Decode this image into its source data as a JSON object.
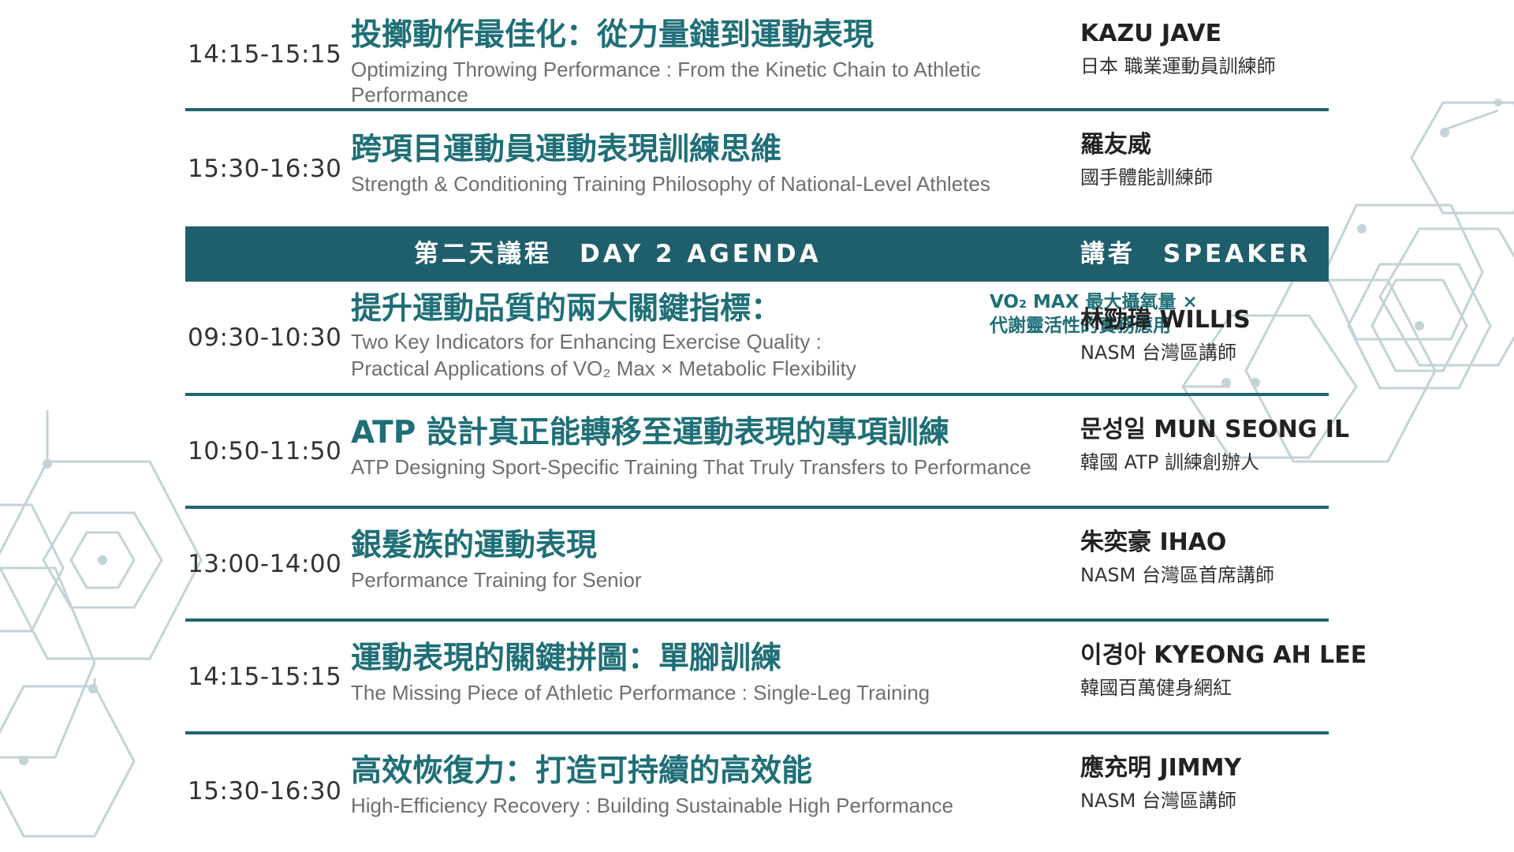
{
  "day1_sessions": [
    {
      "time": "14:15-15:15",
      "title_zh": "投擲動作最佳化：從力量鏈到運動表現",
      "title_en": "Optimizing Throwing Performance : From the Kinetic Chain to Athletic Performance",
      "speaker_name": "KAZU JAVE",
      "speaker_role": "日本 職業運動員訓練師"
    },
    {
      "time": "15:30-16:30",
      "title_zh": "跨項目運動員運動表現訓練思維",
      "title_en": "Strength & Conditioning Training Philosophy of National-Level Athletes",
      "speaker_name": "羅友威",
      "speaker_role": "國手體能訓練師"
    }
  ],
  "day2_header": {
    "agenda_label": "第二天議程　DAY 2 AGENDA",
    "speaker_label": "講者　SPEAKER"
  },
  "day2_sessions": [
    {
      "time": "09:30-10:30",
      "title_zh": "提升運動品質的兩大關鍵指標：",
      "subtitle_line1": "VO₂ MAX 最大攝氧量 ×",
      "subtitle_line2": "代謝靈活性的實務應用",
      "title_en_line1": "Two Key Indicators for Enhancing Exercise Quality :",
      "title_en_line2": "Practical Applications of VO₂ Max × Metabolic Flexibility",
      "speaker_name": "林勁瑋 WILLIS",
      "speaker_role": "NASM 台灣區講師"
    },
    {
      "time": "10:50-11:50",
      "title_zh": "ATP 設計真正能轉移至運動表現的專項訓練",
      "title_en": "ATP Designing Sport-Specific Training That Truly Transfers to Performance",
      "speaker_name": "문성일 MUN SEONG IL",
      "speaker_role": "韓國 ATP 訓練創辦人"
    },
    {
      "time": "13:00-14:00",
      "title_zh": "銀髮族的運動表現",
      "title_en": "Performance Training for Senior",
      "speaker_name": "朱奕豪 IHAO",
      "speaker_role": "NASM 台灣區首席講師"
    },
    {
      "time": "14:15-15:15",
      "title_zh": "運動表現的關鍵拼圖：單腳訓練",
      "title_en": "The Missing Piece of Athletic Performance : Single-Leg Training",
      "speaker_name": "이경아 KYEONG AH LEE",
      "speaker_role": "韓國百萬健身網紅"
    },
    {
      "time": "15:30-16:30",
      "title_zh": "高效恢復力：打造可持續的高效能",
      "title_en": "High-Efficiency Recovery : Building Sustainable High Performance",
      "speaker_name": "應充明 JIMMY",
      "speaker_role": "NASM 台灣區講師"
    }
  ],
  "colors": {
    "accent": "#1f5f6b",
    "title": "#1f6f77",
    "decor": "#b9cdd1"
  }
}
